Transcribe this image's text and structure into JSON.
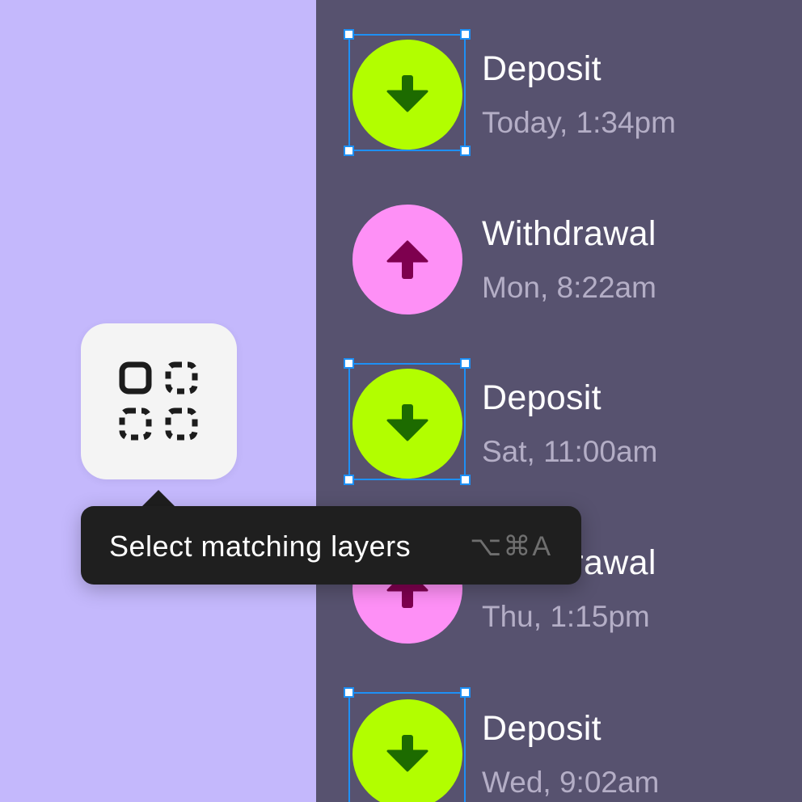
{
  "transactions": [
    {
      "title": "Deposit",
      "time": "Today, 1:34pm",
      "type": "deposit",
      "icon": "arrow-down-icon",
      "selected": true
    },
    {
      "title": "Withdrawal",
      "time": "Mon, 8:22am",
      "type": "withdrawal",
      "icon": "arrow-up-icon",
      "selected": false
    },
    {
      "title": "Deposit",
      "time": "Sat, 11:00am",
      "type": "deposit",
      "icon": "arrow-down-icon",
      "selected": true
    },
    {
      "title": "Withdrawal",
      "time": "Thu, 1:15pm",
      "type": "withdrawal",
      "icon": "arrow-up-icon",
      "selected": false
    },
    {
      "title": "Deposit",
      "time": "Wed, 9:02am",
      "type": "deposit",
      "icon": "arrow-down-icon",
      "selected": true
    }
  ],
  "tool": {
    "icon": "select-matching-layers-icon",
    "tooltip_label": "Select matching layers",
    "shortcut": "⌥⌘A"
  },
  "colors": {
    "left_background": "#c4b8fc",
    "right_background": "#57526f",
    "deposit_circle": "#b2fe00",
    "deposit_arrow": "#1d6b00",
    "withdrawal_circle": "#fe90f6",
    "withdrawal_arrow": "#7e004f",
    "selection": "#1e90f5",
    "tooltip_background": "#1f1f1f"
  }
}
